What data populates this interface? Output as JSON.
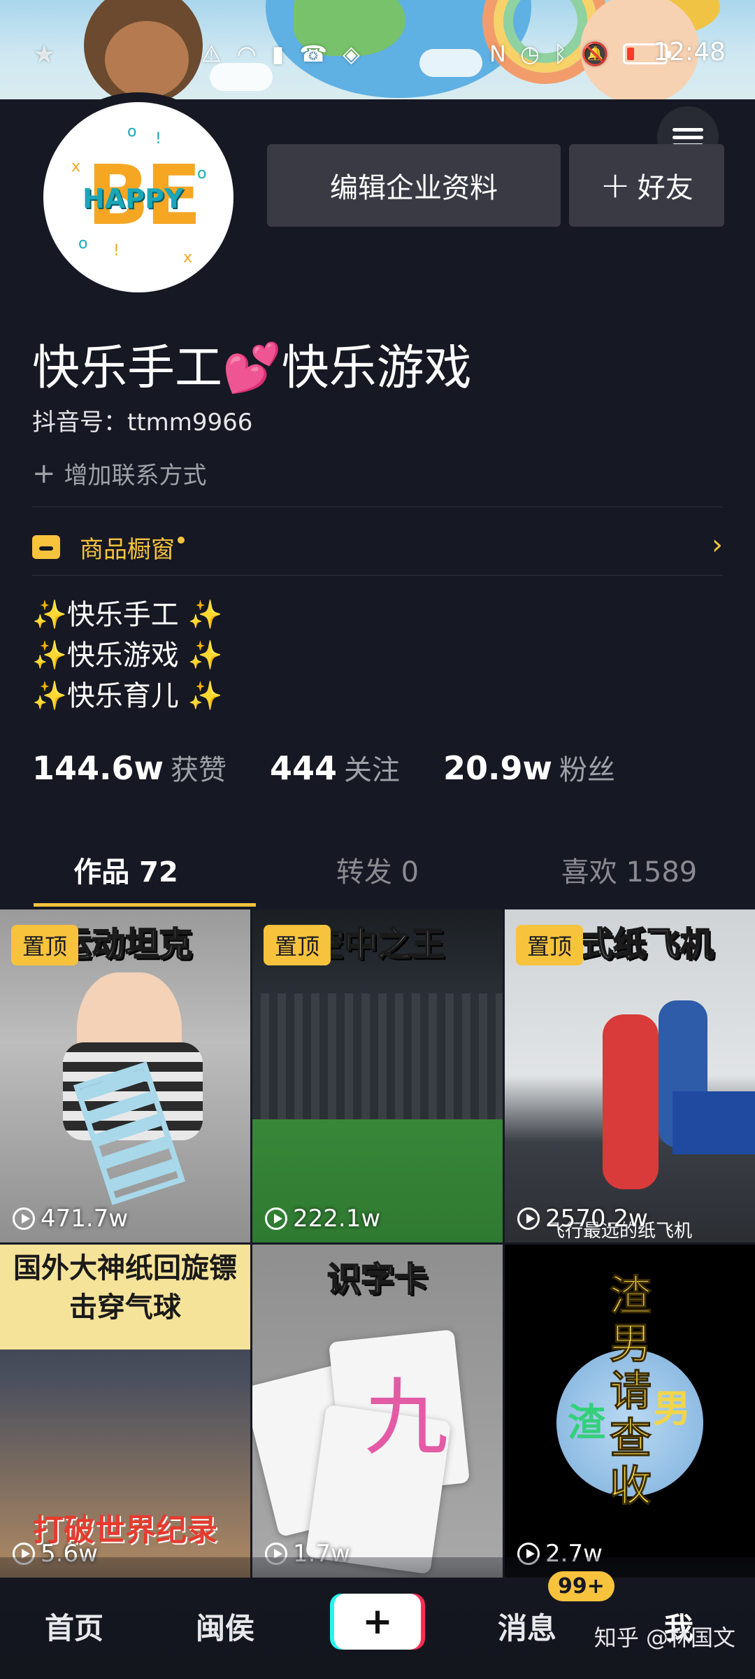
{
  "status_bar": {
    "time": "12:48"
  },
  "header": {
    "edit_button": "编辑企业资料",
    "friend_button": "好友",
    "friend_plus": "+"
  },
  "avatar": {
    "big_text": "BE",
    "small_text": "HAPPY"
  },
  "profile": {
    "name": "快乐手工💕快乐游戏",
    "douyin_id": "抖音号：ttmm9966",
    "add_contact": "增加联系方式",
    "shop_label": "商品橱窗",
    "bio": [
      "快乐手工",
      "快乐游戏",
      "快乐育儿"
    ],
    "spark": "✨"
  },
  "stats": [
    {
      "value": "144.6w",
      "label": "获赞"
    },
    {
      "value": "444",
      "label": "关注"
    },
    {
      "value": "20.9w",
      "label": "粉丝"
    }
  ],
  "tabs": [
    {
      "label": "作品 72",
      "active": true
    },
    {
      "label": "转发 0",
      "active": false
    },
    {
      "label": "喜欢 1589",
      "active": false
    }
  ],
  "videos": [
    {
      "title": "运动坦克",
      "pinned": true,
      "pin_label": "置顶",
      "plays": "471.7w"
    },
    {
      "title": "空中之王",
      "pinned": true,
      "pin_label": "置顶",
      "plays": "222.1w"
    },
    {
      "title": "花式纸飞机",
      "pinned": true,
      "pin_label": "置顶",
      "plays": "2570.2w",
      "subtitle": "飞行最远的纸飞机"
    },
    {
      "title": "国外大神纸回旋镖\n击穿气球",
      "pinned": false,
      "plays": "5.6w",
      "bottom_title": "打破世界纪录"
    },
    {
      "title": "识字卡",
      "pinned": false,
      "plays": "1.7w",
      "char": "九"
    },
    {
      "title": "渣男请查收",
      "pinned": false,
      "plays": "2.7w",
      "side_left": "渣",
      "side_right": "男"
    }
  ],
  "bottom_nav": {
    "home": "首页",
    "friends": "闽侯",
    "create": "+",
    "messages": "消息",
    "messages_badge": "99+",
    "me": "我"
  },
  "watermark": "知乎 @林国文"
}
